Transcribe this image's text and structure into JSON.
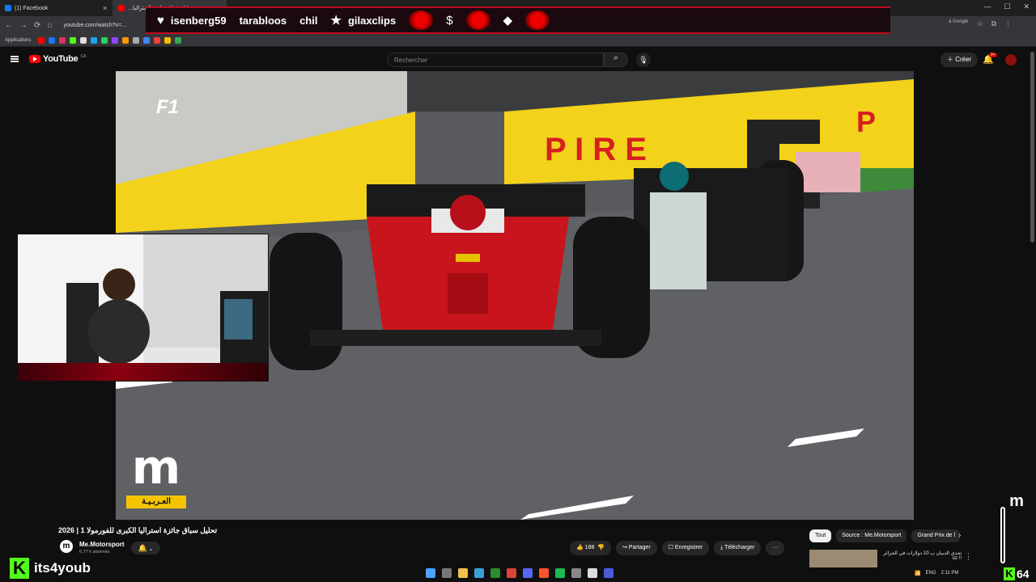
{
  "browser": {
    "tabs": [
      {
        "label": "(1) Facebook",
        "close": "✕"
      },
      {
        "label": "...تحليل سباق جائزة أستراليا",
        "close": "✕"
      }
    ],
    "url": "youtube.com/watch?v=...",
    "window_controls": [
      "—",
      "☐",
      "✕"
    ],
    "bookmarks_label": "Applications",
    "google_label": "à Google"
  },
  "stream_overlay": {
    "items": [
      {
        "icon": "heart-icon",
        "text": "isenberg59"
      },
      {
        "icon": "none",
        "text": "tarabloos"
      },
      {
        "icon": "none",
        "text": "chil"
      },
      {
        "icon": "star-icon",
        "text": "gilaxclips"
      }
    ],
    "brand_name": "its4youb",
    "kick_count": "64"
  },
  "youtube": {
    "logo_text": "YouTube",
    "country": "CA",
    "search_placeholder": "Rechercher",
    "create_label": "Créer",
    "notif_badge": "9+",
    "video_title": "تحليل سباق جائزة استراليا الكبرى للفورمولا 1 | 2026",
    "channel_name": "Me.Motorsport",
    "subscribers": "6,77 k abonnés",
    "likes": "188",
    "actions": {
      "share": "Partager",
      "save": "Enregistrer",
      "download": "Télécharger",
      "more": "···"
    },
    "chips": [
      "Tout",
      "Source : Me.Motorsport",
      "Grand Prix de l"
    ],
    "recommended_title": "تحدي الديبان ب 10 دولارات في الجزائر !! oz",
    "watermark": "العـربـيـة",
    "watermark_letter": "m",
    "f1_logo": "F1"
  },
  "colors": {
    "accent": "#ff0000",
    "kick_green": "#53fc18",
    "overlay_red": "#c20a1e",
    "watermark_yellow": "#f5c400"
  },
  "tray": {
    "lang": "ENG",
    "time": "2:11 PM"
  }
}
